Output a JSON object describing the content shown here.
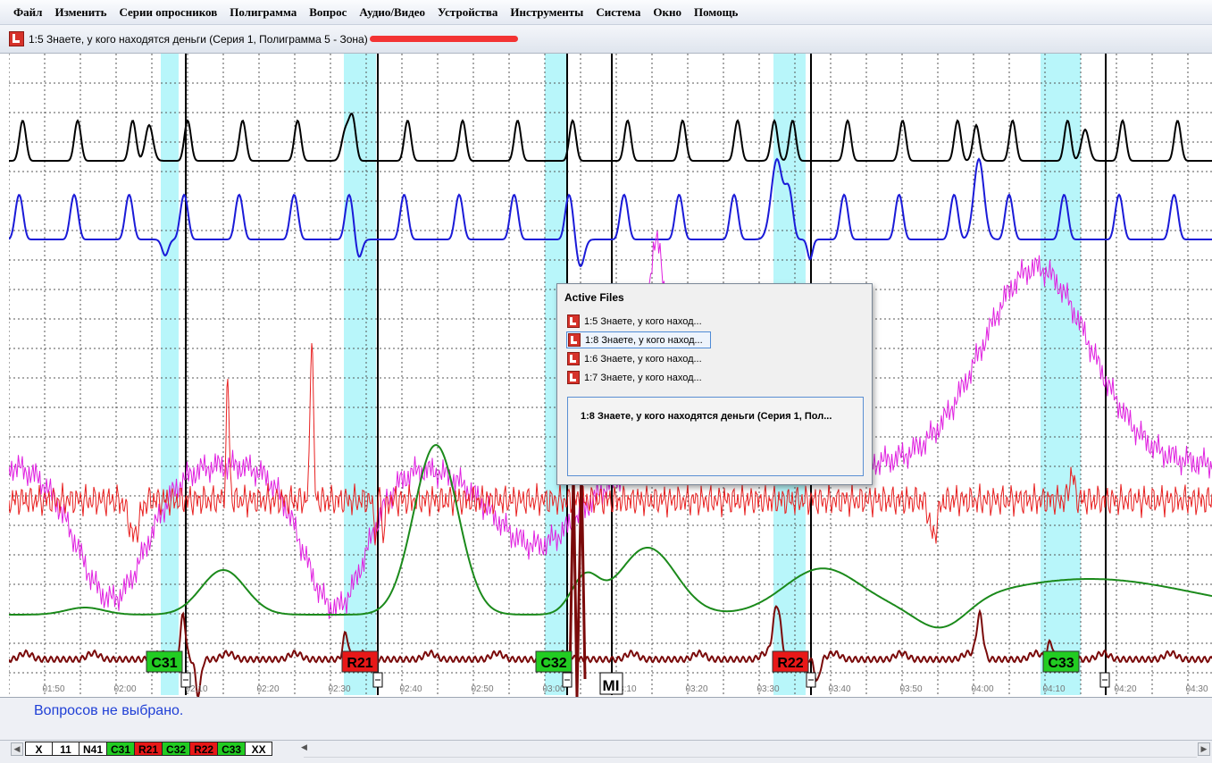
{
  "menu": [
    "Файл",
    "Изменить",
    "Серии опросников",
    "Полиграмма",
    "Вопрос",
    "Аудио/Видео",
    "Устройства",
    "Инструменты",
    "Система",
    "Окно",
    "Помощь"
  ],
  "window": {
    "title": "1:5  Знаете, у кого находятся деньги (Серия 1, Полиграмма 5 - Зона)"
  },
  "chart_data": {
    "type": "line",
    "x_tick_labels": [
      "01:50",
      "02:00",
      "02:10",
      "02:20",
      "02:30",
      "02:40",
      "02:50",
      "03:00",
      "03:10",
      "03:20",
      "03:30",
      "03:40",
      "03:50",
      "04:00",
      "04:10",
      "04:20",
      "04:30"
    ],
    "question_marks": [
      {
        "label": "C31",
        "color": "#22cc22"
      },
      {
        "label": "R21",
        "color": "#e81818"
      },
      {
        "label": "C32",
        "color": "#22cc22"
      },
      {
        "label": "R22",
        "color": "#e81818"
      },
      {
        "label": "C33",
        "color": "#22cc22"
      }
    ],
    "annotation": "MI",
    "channel_colors": [
      "#000000",
      "#1a1ad8",
      "#e020e0",
      "#e82020",
      "#1b8a1b",
      "#7a0a0a"
    ],
    "highlight_color": "#b8f6fa"
  },
  "status": {
    "message": "Вопросов не выбрано."
  },
  "question_tabs": [
    {
      "label": "X",
      "bg": "#ffffff",
      "fg": "#000000"
    },
    {
      "label": "11",
      "bg": "#ffffff",
      "fg": "#000000"
    },
    {
      "label": "N41",
      "bg": "#ffffff",
      "fg": "#000000"
    },
    {
      "label": "C31",
      "bg": "#22cc22",
      "fg": "#000000"
    },
    {
      "label": "R21",
      "bg": "#e81818",
      "fg": "#000000"
    },
    {
      "label": "C32",
      "bg": "#22cc22",
      "fg": "#000000"
    },
    {
      "label": "R22",
      "bg": "#e81818",
      "fg": "#000000"
    },
    {
      "label": "C33",
      "bg": "#22cc22",
      "fg": "#000000"
    },
    {
      "label": "XX",
      "bg": "#ffffff",
      "fg": "#000000"
    }
  ],
  "active_files": {
    "title": "Active Files",
    "items": [
      "1:5  Знаете, у кого наход...",
      "1:8  Знаете, у кого наход...",
      "1:6  Знаете, у кого наход...",
      "1:7  Знаете, у кого наход..."
    ],
    "selected_index": 1,
    "preview": "1:8  Знаете, у кого находятся деньги (Серия 1, Пол..."
  }
}
